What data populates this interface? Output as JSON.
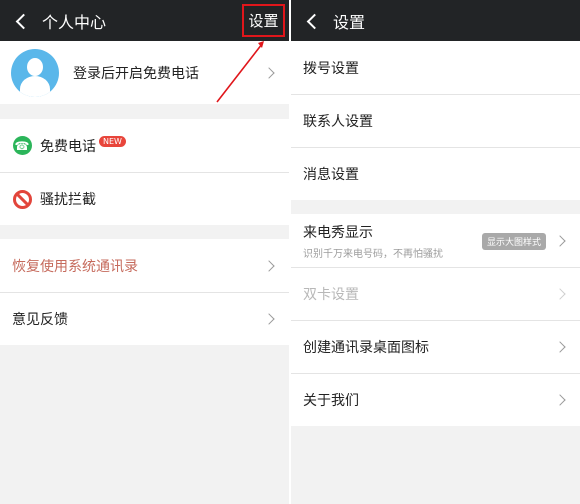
{
  "left": {
    "header": {
      "title": "个人中心",
      "settings_label": "设置"
    },
    "profile": {
      "label": "登录后开启免费电话"
    },
    "group1": [
      {
        "label": "免费电话",
        "badge": "NEW"
      },
      {
        "label": "骚扰拦截"
      }
    ],
    "group2": [
      {
        "label": "恢复使用系统通讯录"
      },
      {
        "label": "意见反馈"
      }
    ]
  },
  "right": {
    "header": {
      "title": "设置"
    },
    "group1": [
      {
        "label": "拨号设置"
      },
      {
        "label": "联系人设置"
      },
      {
        "label": "消息设置"
      }
    ],
    "group2": {
      "caller_show": {
        "label": "来电秀显示",
        "sub": "识别千万来电号码，不再怕骚扰",
        "badge": "显示大图样式"
      },
      "dual_sim": {
        "label": "双卡设置"
      },
      "shortcut": {
        "label": "创建通讯录桌面图标"
      },
      "about": {
        "label": "关于我们"
      }
    }
  },
  "colors": {
    "header_bg": "#222426",
    "highlight_border": "#e0161b",
    "accent_red": "#c66b5d",
    "avatar_blue": "#5ab7ea"
  }
}
